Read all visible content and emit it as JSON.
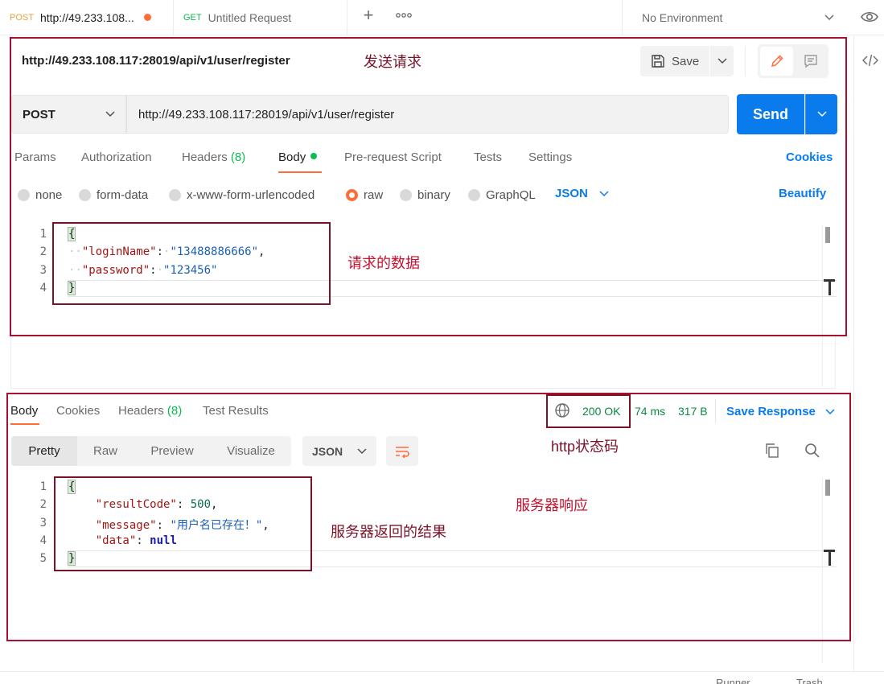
{
  "tabs": [
    {
      "method": "POST",
      "title": "http://49.233.108..."
    },
    {
      "method": "GET",
      "title": "Untitled Request"
    }
  ],
  "tab_actions": {
    "new_tab": "+",
    "more": "ooo"
  },
  "environment": {
    "selected": "No Environment"
  },
  "request": {
    "name": "http://49.233.108.117:28019/api/v1/user/register",
    "method": "POST",
    "url": "http://49.233.108.117:28019/api/v1/user/register",
    "save_label": "Save",
    "send_label": "Send"
  },
  "request_tabs": {
    "params": "Params",
    "authorization": "Authorization",
    "headers": "Headers",
    "headers_count": "(8)",
    "body": "Body",
    "pre_request": "Pre-request Script",
    "tests": "Tests",
    "settings": "Settings",
    "cookies": "Cookies"
  },
  "body_types": {
    "none": "none",
    "form_data": "form-data",
    "urlencoded": "x-www-form-urlencoded",
    "raw": "raw",
    "binary": "binary",
    "graphql": "GraphQL",
    "format": "JSON",
    "beautify": "Beautify"
  },
  "request_body_lines": [
    {
      "num": "1",
      "text": "{"
    },
    {
      "num": "2",
      "key": "\"loginName\"",
      "value": "\"13488886666\"",
      "trail": ","
    },
    {
      "num": "3",
      "key": "\"password\"",
      "value": "\"123456\"",
      "trail": ""
    },
    {
      "num": "4",
      "text": "}"
    }
  ],
  "response_tabs": {
    "body": "Body",
    "cookies": "Cookies",
    "headers": "Headers",
    "headers_count": "(8)",
    "test_results": "Test Results"
  },
  "response_status": {
    "code": "200 OK",
    "time": "74 ms",
    "size": "317 B",
    "save_response": "Save Response"
  },
  "response_view": {
    "pretty": "Pretty",
    "raw": "Raw",
    "preview": "Preview",
    "visualize": "Visualize",
    "format": "JSON"
  },
  "response_body_lines": [
    {
      "num": "1",
      "text": "{"
    },
    {
      "num": "2",
      "key": "\"resultCode\"",
      "value": "500",
      "trail": ","
    },
    {
      "num": "3",
      "key": "\"message\"",
      "value": "\"用户名已存在！\"",
      "trail": ","
    },
    {
      "num": "4",
      "key": "\"data\"",
      "value": "null",
      "trail": ""
    },
    {
      "num": "5",
      "text": "}"
    }
  ],
  "annotations": {
    "send_request": "发送请求",
    "request_data": "请求的数据",
    "http_status": "http状态码",
    "server_response": "服务器响应",
    "server_result": "服务器返回的结果"
  },
  "footer": {
    "runner": "Runner",
    "trash": "Trash"
  },
  "colors": {
    "accent": "#ff6c37",
    "primary": "#097bed",
    "success": "#0cbb52",
    "annotation": "#c8102e"
  }
}
